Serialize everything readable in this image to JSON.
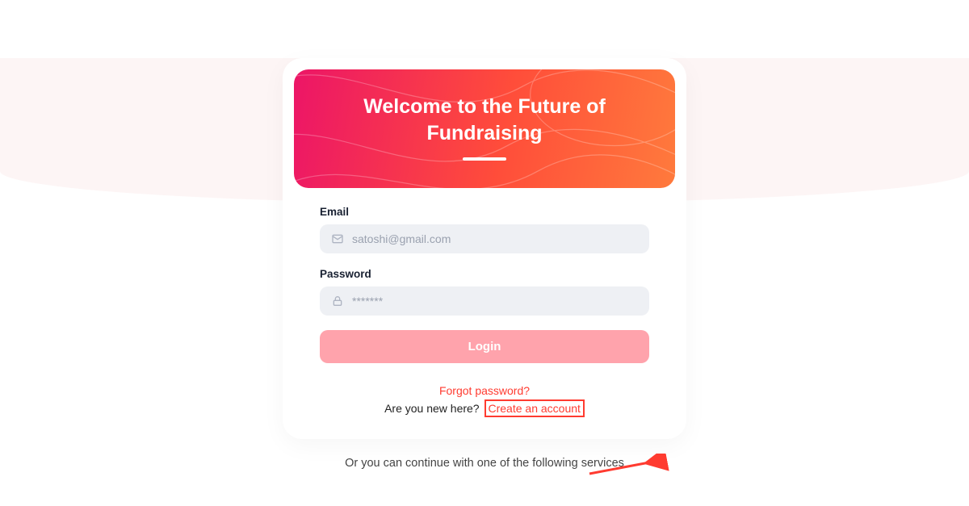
{
  "hero": {
    "title": "Welcome to the Future of Fundraising"
  },
  "form": {
    "email_label": "Email",
    "email_placeholder": "satoshi@gmail.com",
    "password_label": "Password",
    "password_placeholder": "*******",
    "login_button": "Login"
  },
  "links": {
    "forgot": "Forgot password?",
    "new_here": "Are you new here?",
    "create_account": "Create an account"
  },
  "footer": {
    "or_continue": "Or you can continue with one of the following services"
  },
  "colors": {
    "accent": "#ff3b30",
    "button": "#ffa3ac",
    "input_bg": "#eef0f4"
  },
  "icons": {
    "email": "mail-icon",
    "password": "lock-icon"
  }
}
